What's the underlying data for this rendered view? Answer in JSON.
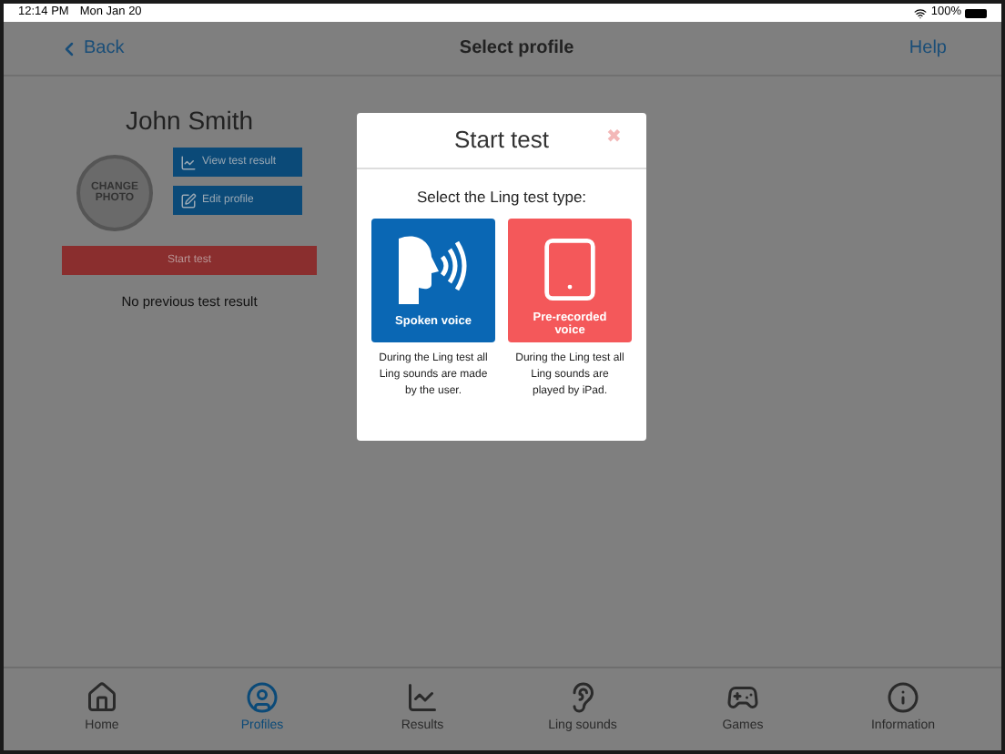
{
  "status_bar": {
    "time": "12:14 PM",
    "date": "Mon Jan 20",
    "battery": "100%"
  },
  "nav": {
    "back": "Back",
    "title": "Select profile",
    "help": "Help"
  },
  "profile": {
    "name": "John Smith",
    "photo_label": "CHANGE PHOTO",
    "actions": [
      {
        "label": "View test result",
        "kind": "chart"
      },
      {
        "label": "Edit profile",
        "kind": "edit"
      }
    ],
    "start_test": "Start test",
    "note": "No previous test result"
  },
  "dialog": {
    "title": "Start test",
    "close": "✖",
    "prompt": "Select the Ling test type:",
    "options": [
      {
        "kind": "spoken",
        "label": "Spoken voice",
        "description": "During the Ling test all Ling sounds are made by the user."
      },
      {
        "kind": "recorded",
        "label": "Pre-recorded voice",
        "description": "During the Ling test all Ling sounds are played by iPad."
      }
    ]
  },
  "tabs": [
    {
      "kind": "home",
      "label": "Home",
      "selected": false
    },
    {
      "kind": "profiles",
      "label": "Profiles",
      "selected": true
    },
    {
      "kind": "results",
      "label": "Results",
      "selected": false
    },
    {
      "kind": "ling",
      "label": "Ling sounds",
      "selected": false
    },
    {
      "kind": "games",
      "label": "Games",
      "selected": false
    },
    {
      "kind": "info",
      "label": "Information",
      "selected": false
    }
  ]
}
